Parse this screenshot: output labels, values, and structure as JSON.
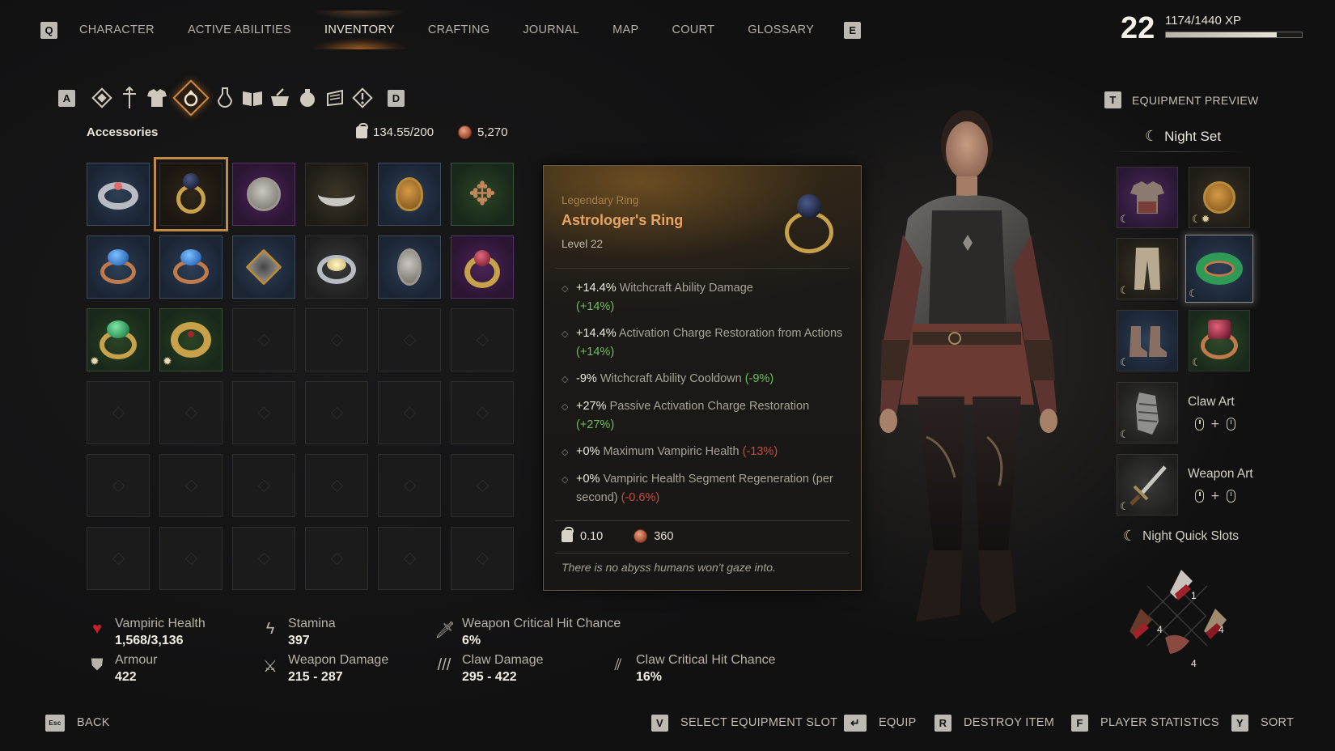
{
  "nav": {
    "left_key": "Q",
    "right_key": "E",
    "tabs": [
      {
        "label": "CHARACTER",
        "active": false
      },
      {
        "label": "ACTIVE ABILITIES",
        "active": false
      },
      {
        "label": "INVENTORY",
        "active": true
      },
      {
        "label": "CRAFTING",
        "active": false
      },
      {
        "label": "JOURNAL",
        "active": false
      },
      {
        "label": "MAP",
        "active": false
      },
      {
        "label": "COURT",
        "active": false
      },
      {
        "label": "GLOSSARY",
        "active": false
      }
    ]
  },
  "player": {
    "level": "22",
    "xp": "1174/1440 XP",
    "xp_fraction": 0.815
  },
  "categories": {
    "left_key": "A",
    "right_key": "D",
    "selected": "accessories-icon"
  },
  "inventory": {
    "section_title": "Accessories",
    "weight": "134.55/200",
    "gold": "5,270"
  },
  "tooltip": {
    "rarity": "Legendary Ring",
    "name": "Astrologer's Ring",
    "level": "Level 22",
    "stats": [
      {
        "value": "+14.4%",
        "text": "Witchcraft Ability Damage",
        "delta": "(+14%)",
        "delta_type": "pos"
      },
      {
        "value": "+14.4%",
        "text": "Activation Charge Restoration from Actions",
        "delta": "(+14%)",
        "delta_type": "pos"
      },
      {
        "value": "-9%",
        "text": "Witchcraft Ability Cooldown",
        "delta": "(-9%)",
        "delta_type": "pos"
      },
      {
        "value": "+27%",
        "text": "Passive Activation Charge Restoration",
        "delta": "(+27%)",
        "delta_type": "pos"
      },
      {
        "value": "+0%",
        "text": "Maximum Vampiric Health",
        "delta": "(-13%)",
        "delta_type": "neg"
      },
      {
        "value": "+0%",
        "text": "Vampiric Health Segment Regeneration (per second)",
        "delta": "(-0.6%)",
        "delta_type": "neg"
      }
    ],
    "weight": "0.10",
    "price": "360",
    "quote": "There is no abyss humans won't gaze into."
  },
  "equipment": {
    "preview_key": "T",
    "preview_label": "EQUIPMENT PREVIEW",
    "set_name": "Night Set",
    "claw_art": "Claw Art",
    "weapon_art": "Weapon Art",
    "plus": "+",
    "quick_slots_label": "Night Quick Slots",
    "quick_counts": [
      "1",
      "4",
      "4",
      "4"
    ]
  },
  "player_stats": {
    "vampiric_health_label": "Vampiric Health",
    "vampiric_health": "1,568/3,136",
    "armour_label": "Armour",
    "armour": "422",
    "stamina_label": "Stamina",
    "stamina": "397",
    "weapon_damage_label": "Weapon Damage",
    "weapon_damage": "215 - 287",
    "weapon_crit_label": "Weapon Critical Hit Chance",
    "weapon_crit": "6%",
    "claw_damage_label": "Claw Damage",
    "claw_damage": "295 - 422",
    "claw_crit_label": "Claw Critical Hit Chance",
    "claw_crit": "16%"
  },
  "bottom_bar": {
    "back_key": "Esc",
    "back": "BACK",
    "select_key": "V",
    "select": "SELECT EQUIPMENT SLOT",
    "equip": "EQUIP",
    "destroy_key": "R",
    "destroy": "DESTROY ITEM",
    "stats_key": "F",
    "stats": "PLAYER STATISTICS",
    "sort_key": "Y",
    "sort": "SORT"
  },
  "colors": {
    "accent": "#c18a45",
    "legendary_name": "#e7a563",
    "positive": "#6fbf58",
    "negative": "#c94a3e"
  }
}
